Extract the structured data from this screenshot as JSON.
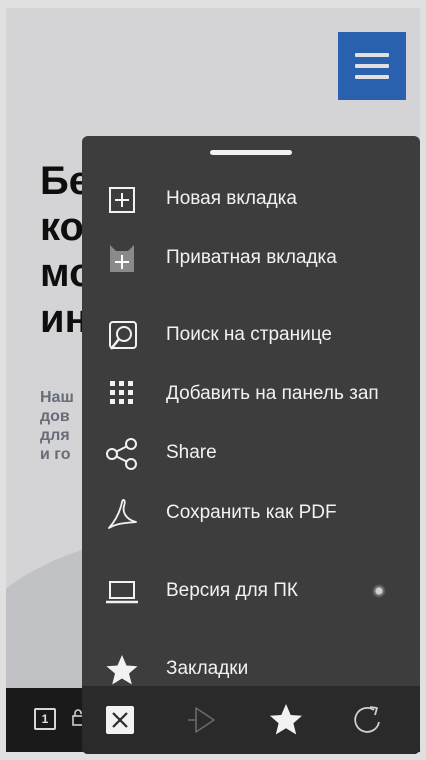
{
  "page": {
    "hero_title": "Бе\nко\nмо\nин",
    "hero_text": "Наш\nдов\nдля\nи го"
  },
  "browser_bar": {
    "tab_count": "1"
  },
  "menu": {
    "items": [
      {
        "label": "Новая вкладка",
        "icon": "new-tab-icon"
      },
      {
        "label": "Приватная вкладка",
        "icon": "private-tab-icon"
      },
      {
        "label": "Поиск на странице",
        "icon": "find-in-page-icon"
      },
      {
        "label": "Добавить на панель зап",
        "icon": "speed-dial-grid-icon"
      },
      {
        "label": "Share",
        "icon": "share-icon"
      },
      {
        "label": "Сохранить как PDF",
        "icon": "pdf-icon"
      },
      {
        "label": "Версия для ПК",
        "icon": "laptop-icon"
      },
      {
        "label": "Закладки",
        "icon": "star-icon"
      }
    ],
    "actions": [
      "close-icon",
      "forward-icon",
      "bookmark-star-icon",
      "reload-icon"
    ]
  },
  "colors": {
    "sheet_bg": "#3d3d3d",
    "action_bar_bg": "#2a2a2a",
    "accent_blue": "#2f6fc7",
    "text": "#f2f2f2"
  }
}
